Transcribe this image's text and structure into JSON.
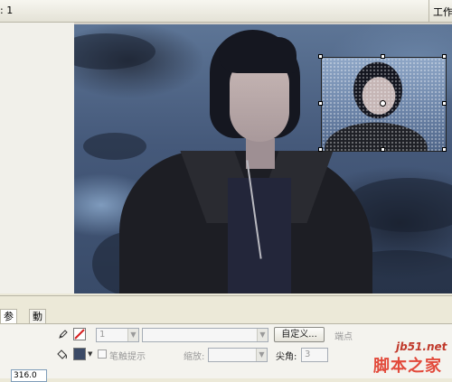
{
  "top_bar": {
    "scene_label": ": 1",
    "workspace_label": "工作"
  },
  "properties": {
    "tabs": [
      {
        "label": "参数"
      },
      {
        "label": "動作"
      }
    ],
    "stroke_width_value": "1",
    "custom_button_label": "自定义...",
    "endpoint_label": "端点",
    "stroke_hint_label": "笔触提示",
    "scale_label": "缩放:",
    "corner_label": "尖角:",
    "corner_value": "3",
    "bottom_field_value": "316.0"
  },
  "watermark": {
    "site": "jb51.net",
    "name": "脚本之家"
  },
  "colors": {
    "panel_bg": "#ece9d8",
    "stroke_color_swatch": "#d62020",
    "fill_color_swatch": "#3b4a66",
    "watermark_red": "#e24a3b"
  },
  "icons": {
    "pencil": "pencil-icon",
    "paint_bucket": "paint-bucket-icon"
  }
}
